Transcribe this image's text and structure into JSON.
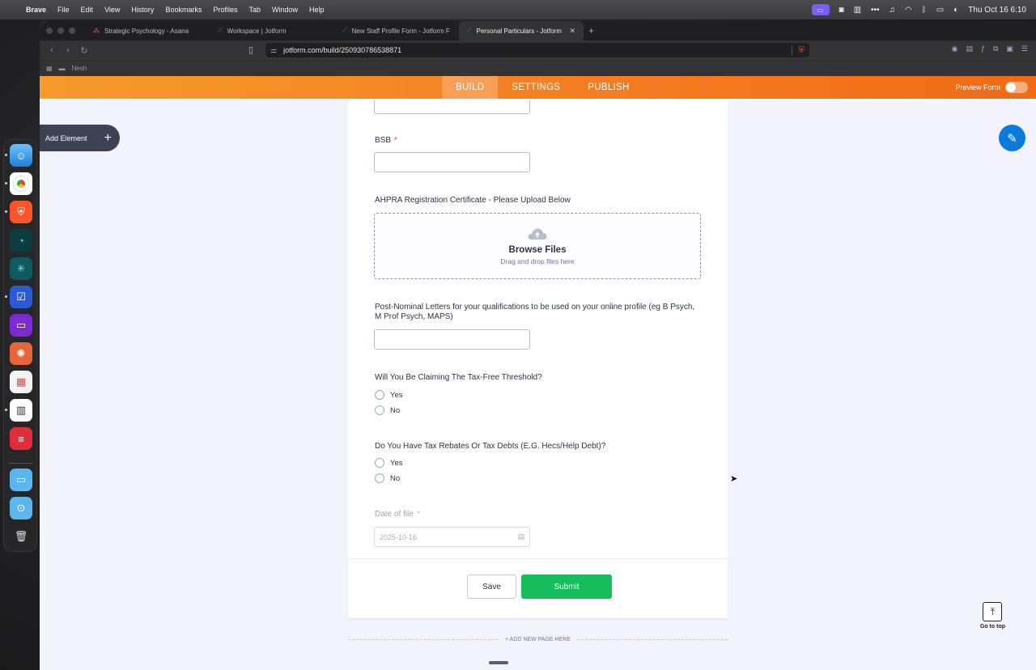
{
  "menubar": {
    "app": "Brave",
    "items": [
      "File",
      "Edit",
      "View",
      "History",
      "Bookmarks",
      "Profiles",
      "Tab",
      "Window",
      "Help"
    ],
    "datetime": "Thu Oct 16  6:10"
  },
  "browser": {
    "tabs": [
      {
        "label": "Strategic Psychology - Asana"
      },
      {
        "label": "Workspace | Jotform"
      },
      {
        "label": "New Staff Profile Form - Jotform F"
      },
      {
        "label": "Personal Particulars - Jotform"
      }
    ],
    "url": "jotform.com/build/250930786538871",
    "bookmark_folder": "Nesh"
  },
  "jotform": {
    "nav": [
      "BUILD",
      "SETTINGS",
      "PUBLISH"
    ],
    "active_nav": "BUILD",
    "preview_label": "Preview Form",
    "add_element_label": "Add Element",
    "go_to_top_label": "Go to top",
    "add_page_label": "+ ADD NEW PAGE HERE"
  },
  "form": {
    "bsb_label": "BSB",
    "required_mark": "*",
    "upload_label": "AHPRA Registration Certificate - Please Upload Below",
    "upload_title": "Browse Files",
    "upload_sub": "Drag and drop files here",
    "postnominal_label": "Post-Nominal Letters for your qualifications to be used on your online profile (eg B Psych, M Prof Psych, MAPS)",
    "tax_threshold_label": "Will You Be Claiming The Tax-Free Threshold?",
    "tax_rebates_label": "Do You Have Tax Rebates Or Tax Debts (E.G. Hecs/Help Debt)?",
    "options": {
      "yes": "Yes",
      "no": "No"
    },
    "date_label": "Date of file",
    "date_value": "2025-10-16",
    "save_label": "Save",
    "submit_label": "Submit"
  },
  "colors": {
    "header_orange": "#f47d22",
    "submit_green": "#18bd5b",
    "required_red": "#f23a3c",
    "designer_blue": "#0b7bd9"
  }
}
